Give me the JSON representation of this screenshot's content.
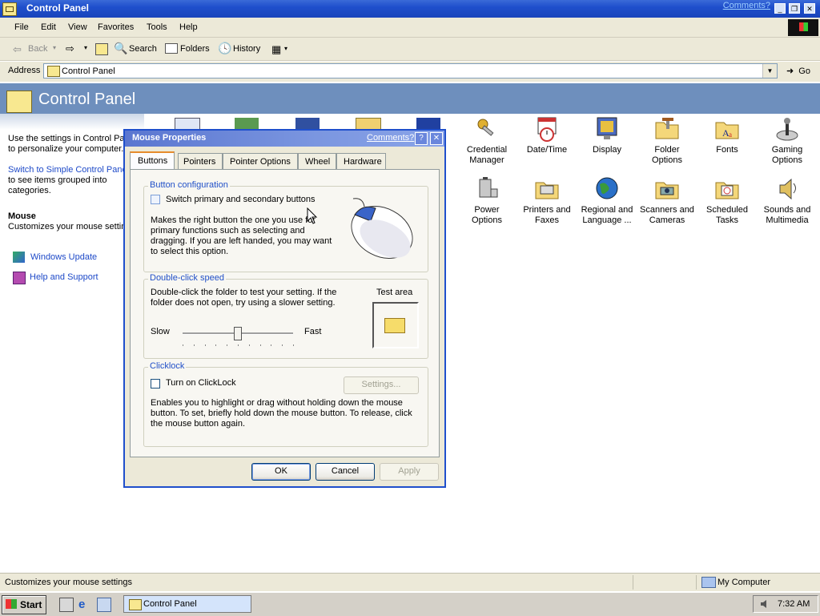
{
  "window": {
    "title": "Control Panel",
    "comments_link": "Comments?"
  },
  "menu": [
    "File",
    "Edit",
    "View",
    "Favorites",
    "Tools",
    "Help"
  ],
  "toolbar": {
    "back": "Back",
    "search": "Search",
    "folders": "Folders",
    "history": "History"
  },
  "address": {
    "label": "Address",
    "value": "Control Panel",
    "go": "Go"
  },
  "header": {
    "title": "Control Panel"
  },
  "left_pane": {
    "intro": "Use the settings in Control Panel to personalize your computer.",
    "switch_link": "Switch to Simple Control Panel",
    "switch_desc": "to see items grouped into categories.",
    "selected_title": "Mouse",
    "selected_desc": "Customizes your mouse settings",
    "links": [
      "Windows Update",
      "Help and Support"
    ]
  },
  "icons": [
    {
      "label": "Credential Manager",
      "icon": "keys-icon"
    },
    {
      "label": "Date/Time",
      "icon": "calendar-clock-icon"
    },
    {
      "label": "Display",
      "icon": "monitor-icon"
    },
    {
      "label": "Folder Options",
      "icon": "folder-tools-icon"
    },
    {
      "label": "Fonts",
      "icon": "fonts-folder-icon"
    },
    {
      "label": "Gaming Options",
      "icon": "joystick-icon"
    },
    {
      "label": "Power Options",
      "icon": "battery-plug-icon"
    },
    {
      "label": "Printers and Faxes",
      "icon": "printer-folder-icon"
    },
    {
      "label": "Regional and Language ...",
      "icon": "globe-icon"
    },
    {
      "label": "Scanners and Cameras",
      "icon": "camera-folder-icon"
    },
    {
      "label": "Scheduled Tasks",
      "icon": "scheduled-folder-icon"
    },
    {
      "label": "Sounds and Multimedia",
      "icon": "speaker-icon"
    }
  ],
  "dialog": {
    "title": "Mouse Properties",
    "comments": "Comments?",
    "tabs": [
      "Buttons",
      "Pointers",
      "Pointer Options",
      "Wheel",
      "Hardware"
    ],
    "active_tab": "Buttons",
    "button_config": {
      "heading": "Button configuration",
      "checkbox_label": "Switch primary and secondary buttons",
      "checked": false,
      "description": "Makes the right button the one you use for primary functions such as selecting and dragging.  If you are left handed, you may want to select this option."
    },
    "double_click": {
      "heading": "Double-click speed",
      "description": "Double-click the folder to test your setting.  If the folder does not open, try using a slower setting.",
      "test_area": "Test area",
      "slow": "Slow",
      "fast": "Fast",
      "slider_value": 0.5
    },
    "clicklock": {
      "heading": "Clicklock",
      "checkbox_label": "Turn on ClickLock",
      "checked": false,
      "settings_btn": "Settings...",
      "description": "Enables you to highlight or drag without holding down the mouse button.  To set, briefly hold down the mouse button.  To release, click the mouse button again."
    },
    "buttons": {
      "ok": "OK",
      "cancel": "Cancel",
      "apply": "Apply"
    }
  },
  "status": {
    "text": "Customizes your mouse settings",
    "zone": "My Computer"
  },
  "taskbar": {
    "start": "Start",
    "task": "Control Panel",
    "clock": "7:32 AM"
  },
  "colors": {
    "titlebar": "#1f4fcc",
    "header_band": "#6e8fbd",
    "link": "#1d49c8",
    "group_heading": "#2150c8",
    "chrome": "#ece9d8"
  }
}
